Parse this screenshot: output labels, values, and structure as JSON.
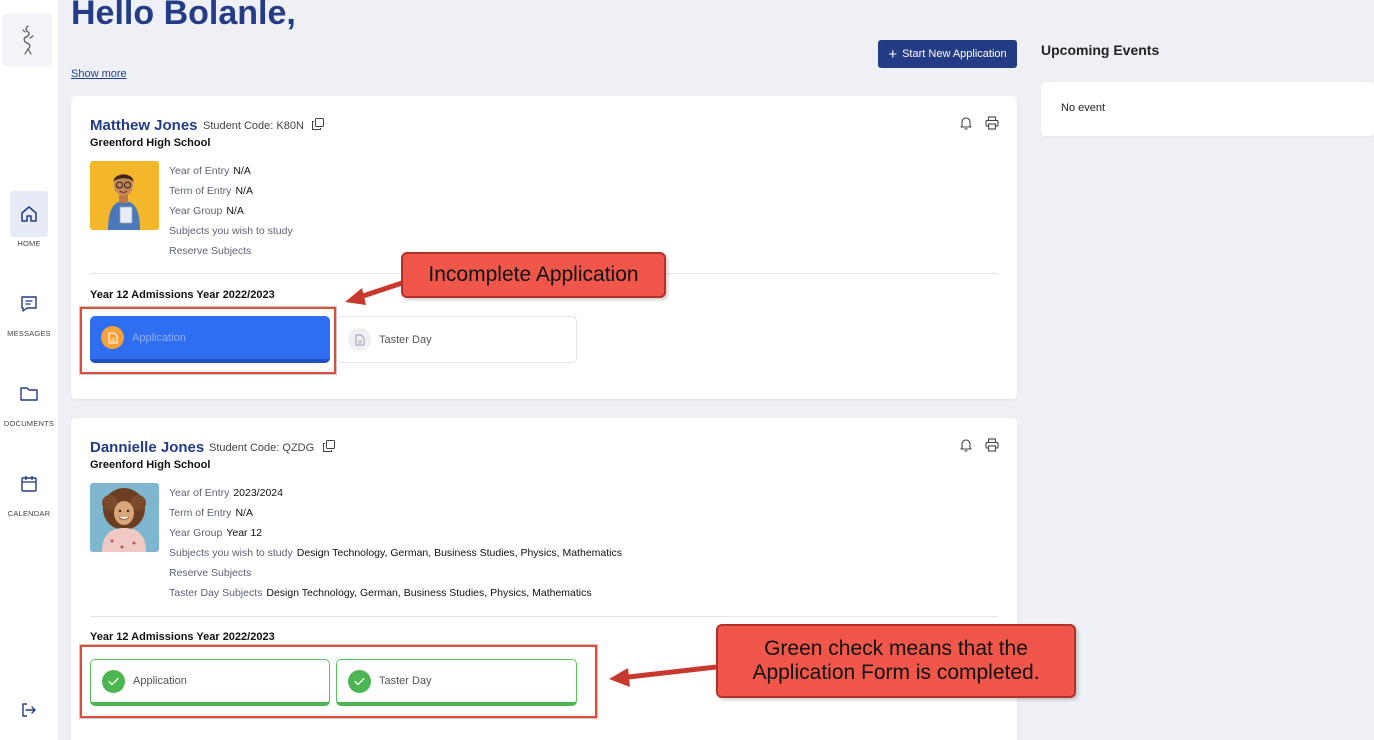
{
  "header": {
    "greeting": "Hello Bolanle,",
    "show_more": "Show more",
    "start_button": "Start New Application"
  },
  "sidebar": {
    "items": [
      {
        "label": "HOME",
        "icon": "home-icon"
      },
      {
        "label": "MESSAGES",
        "icon": "message-icon"
      },
      {
        "label": "DOCUMENTS",
        "icon": "folder-icon"
      },
      {
        "label": "CALENDAR",
        "icon": "calendar-icon"
      }
    ]
  },
  "events": {
    "title": "Upcoming Events",
    "empty_text": "No event"
  },
  "students": [
    {
      "name": "Matthew Jones",
      "code": "Student Code: K80N",
      "school": "Greenford High School",
      "details": [
        {
          "label": "Year of Entry",
          "value": "N/A"
        },
        {
          "label": "Term of Entry",
          "value": "N/A"
        },
        {
          "label": "Year Group",
          "value": "N/A"
        },
        {
          "label": "Subjects you wish to study",
          "value": ""
        },
        {
          "label": "Reserve Subjects",
          "value": ""
        }
      ],
      "section_title": "Year 12 Admissions Year 2022/2023",
      "steps": [
        {
          "label": "Application",
          "status": "incomplete"
        },
        {
          "label": "Taster Day",
          "status": "not-started"
        }
      ]
    },
    {
      "name": "Dannielle Jones",
      "code": "Student Code: QZDG",
      "school": "Greenford High School",
      "details": [
        {
          "label": "Year of Entry",
          "value": "2023/2024"
        },
        {
          "label": "Term of Entry",
          "value": "N/A"
        },
        {
          "label": "Year Group",
          "value": "Year 12"
        },
        {
          "label": "Subjects you wish to study",
          "value": "Design Technology, German, Business Studies, Physics, Mathematics"
        },
        {
          "label": "Reserve Subjects",
          "value": ""
        },
        {
          "label": "Taster Day Subjects",
          "value": "Design Technology, German, Business Studies, Physics, Mathematics"
        }
      ],
      "section_title": "Year 12 Admissions Year 2022/2023",
      "steps": [
        {
          "label": "Application",
          "status": "complete"
        },
        {
          "label": "Taster Day",
          "status": "complete"
        }
      ]
    }
  ],
  "annotations": {
    "incomplete": "Incomplete Application",
    "complete_line1": "Green check means that the",
    "complete_line2": "Application Form is completed."
  },
  "colors": {
    "primary": "#243b86",
    "active_step": "#2f6ef0",
    "complete": "#4cb650",
    "callout": "#f0574a"
  }
}
